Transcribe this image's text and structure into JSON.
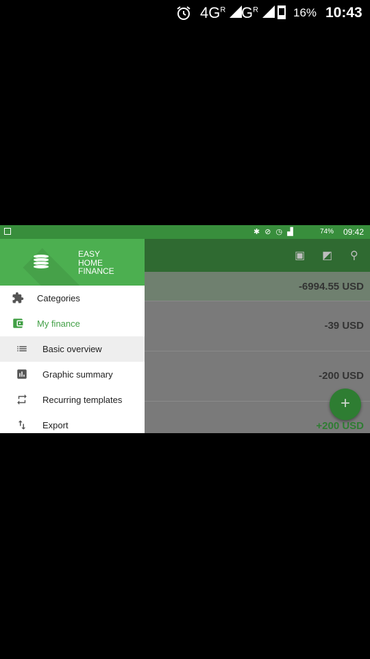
{
  "outer_status": {
    "network1": "4G",
    "network1_sup": "R",
    "network2": "G",
    "network2_sup": "R",
    "battery": "16%",
    "time": "10:43"
  },
  "inner_status": {
    "battery": "74%",
    "time": "09:42"
  },
  "drawer": {
    "logo_lines": [
      "EASY",
      "HOME",
      "FINANCE"
    ],
    "items": [
      {
        "label": "Categories",
        "icon": "puzzle-icon"
      },
      {
        "label": "My finance",
        "icon": "wallet-icon"
      },
      {
        "label": "Basic overview",
        "icon": "list-icon"
      },
      {
        "label": "Graphic summary",
        "icon": "bar-chart-icon"
      },
      {
        "label": "Recurring templates",
        "icon": "repeat-icon"
      },
      {
        "label": "Export",
        "icon": "swap-vertical-icon"
      }
    ]
  },
  "list": {
    "total": "-6994.55 USD",
    "rows": [
      {
        "amount": "-39 USD"
      },
      {
        "amount": "-200 USD"
      },
      {
        "amount": "+200 USD"
      }
    ]
  },
  "fab_label": "+",
  "colors": {
    "brand": "#4caf50",
    "statusbar": "#388e3c",
    "active": "#43a047"
  }
}
